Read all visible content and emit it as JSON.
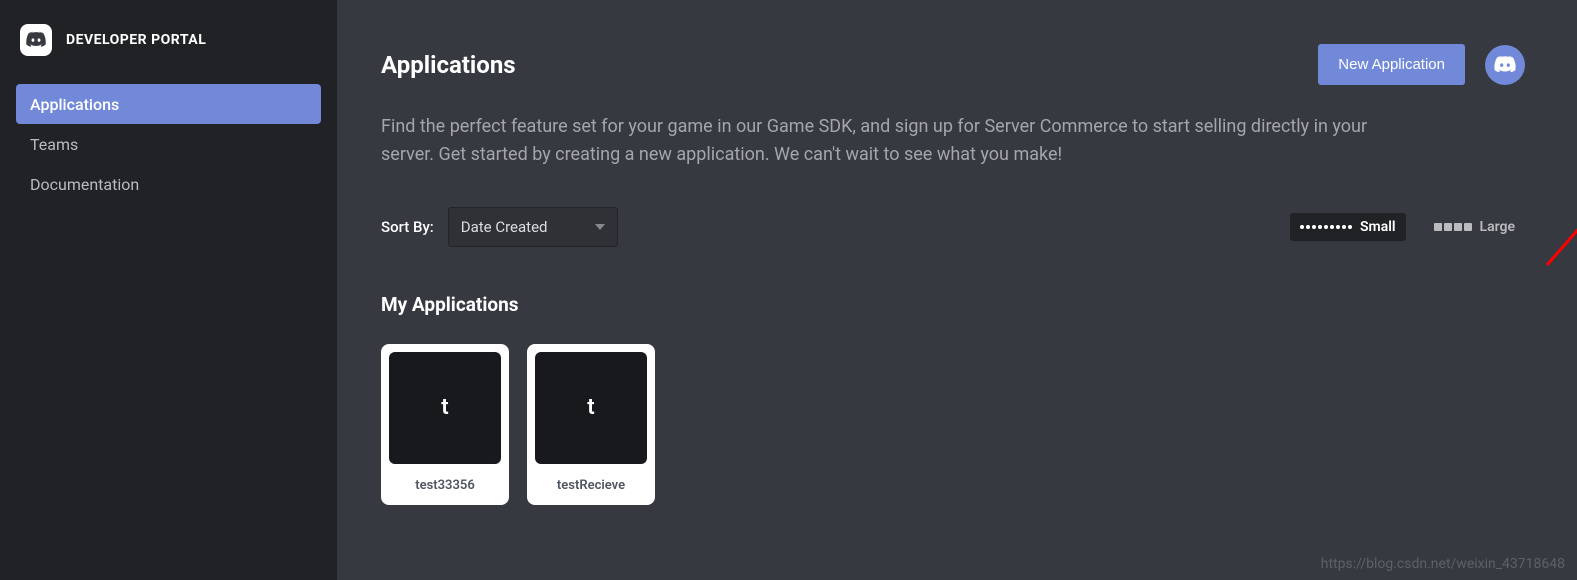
{
  "brand": {
    "title": "DEVELOPER PORTAL"
  },
  "sidebar": {
    "items": [
      {
        "label": "Applications",
        "active": true
      },
      {
        "label": "Teams",
        "active": false
      },
      {
        "label": "Documentation",
        "active": false
      }
    ]
  },
  "header": {
    "title": "Applications",
    "new_button_label": "New Application"
  },
  "description": "Find the perfect feature set for your game in our Game SDK, and sign up for Server Commerce to start selling directly in your server. Get started by creating a new application. We can't wait to see what you make!",
  "sort": {
    "label": "Sort By:",
    "selected": "Date Created"
  },
  "view": {
    "small_label": "Small",
    "large_label": "Large",
    "active": "small"
  },
  "section_title": "My Applications",
  "apps": [
    {
      "initial": "t",
      "name": "test33356"
    },
    {
      "initial": "t",
      "name": "testRecieve"
    }
  ],
  "watermark": "https://blog.csdn.net/weixin_43718648",
  "colors": {
    "accent": "#7289da",
    "sidebar_bg": "#202225",
    "main_bg": "#36393f",
    "highlight": "#ff0000"
  }
}
